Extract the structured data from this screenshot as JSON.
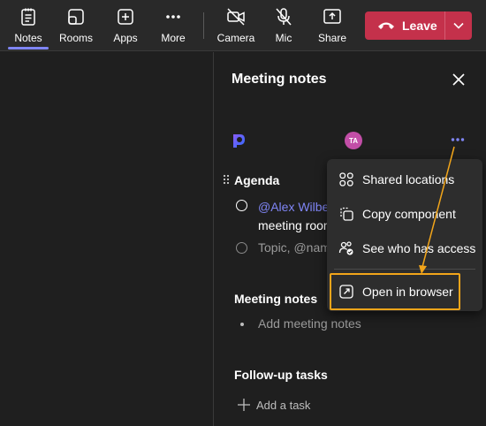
{
  "toolbar": {
    "notes": "Notes",
    "rooms": "Rooms",
    "apps": "Apps",
    "more": "More",
    "camera": "Camera",
    "mic": "Mic",
    "share": "Share",
    "leave": "Leave",
    "active_tab": "Notes"
  },
  "panel": {
    "title": "Meeting notes",
    "avatar_initials": "TA",
    "agenda": {
      "title": "Agenda",
      "items": [
        {
          "mention": "@Alex Wilbe",
          "text": "meeting room"
        },
        {
          "placeholder": "Topic, @name"
        }
      ]
    },
    "meeting_notes": {
      "title": "Meeting notes",
      "placeholder": "Add meeting notes"
    },
    "followup": {
      "title": "Follow-up tasks",
      "add_label": "Add a task"
    }
  },
  "menu": {
    "items": [
      {
        "label": "Shared locations",
        "icon": "shared-locations-icon"
      },
      {
        "label": "Copy component",
        "icon": "copy-component-icon"
      },
      {
        "label": "See who has access",
        "icon": "people-check-icon"
      },
      {
        "label": "Open in browser",
        "icon": "open-in-browser-icon"
      }
    ]
  },
  "colors": {
    "accent": "#7f85f5",
    "leave": "#c4314b",
    "highlight": "#f2a51a",
    "avatar": "#c24ea7"
  }
}
